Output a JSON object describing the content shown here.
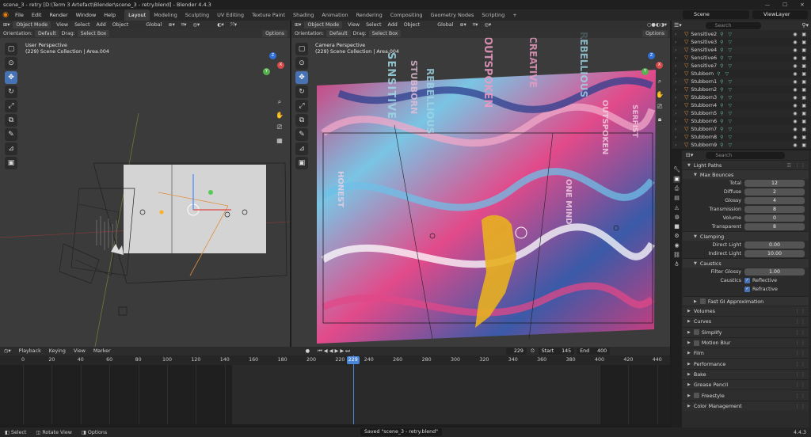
{
  "window": {
    "title": "scene_3 - retry [D:\\Term 3 Artefact\\Blender\\scene_3 - retry.blend] - Blender 4.4.3",
    "controls": [
      "—",
      "☐",
      "✕"
    ]
  },
  "menu": [
    "File",
    "Edit",
    "Render",
    "Window",
    "Help"
  ],
  "workspaces": [
    "Layout",
    "Modeling",
    "Sculpting",
    "UV Editing",
    "Texture Paint",
    "Shading",
    "Animation",
    "Rendering",
    "Compositing",
    "Geometry Nodes",
    "Scripting",
    "+"
  ],
  "active_workspace": "Layout",
  "scene_selector": {
    "scene": "Scene",
    "view_layer": "ViewLayer"
  },
  "viewport_left": {
    "mode": "Object Mode",
    "menus": [
      "View",
      "Select",
      "Add",
      "Object"
    ],
    "transform": "Global",
    "orientation_label": "Orientation:",
    "orientation_value": "Default",
    "drag_label": "Drag:",
    "drag_value": "Select Box",
    "options": "Options",
    "perspective": "User Perspective",
    "collection": "(229) Scene Collection | Area.004"
  },
  "viewport_right": {
    "mode": "Object Mode",
    "menus": [
      "View",
      "Select",
      "Add",
      "Object"
    ],
    "transform": "Global",
    "orientation_label": "Orientation:",
    "orientation_value": "Default",
    "drag_label": "Drag:",
    "drag_value": "Select Box",
    "options": "Options",
    "perspective": "Camera Perspective",
    "collection": "(229) Scene Collection | Area.004"
  },
  "gizmo": {
    "x": "X",
    "y": "Y",
    "z": "Z"
  },
  "timeline": {
    "menus": [
      "Playback",
      "Keying",
      "View",
      "Marker"
    ],
    "current_frame": "229",
    "start_label": "Start",
    "start": "145",
    "end_label": "End",
    "end": "400",
    "ticks": [
      0,
      20,
      40,
      60,
      80,
      100,
      120,
      140,
      160,
      180,
      200,
      220,
      240,
      260,
      280,
      300,
      320,
      340,
      360,
      380,
      400,
      420,
      440
    ],
    "playhead": "229"
  },
  "status": {
    "select": "Select",
    "rotate": "Rotate View",
    "options": "Options",
    "message": "Saved \"scene_3 - retry.blend\"",
    "version": "4.4.3"
  },
  "outliner": {
    "search_placeholder": "Search",
    "items": [
      "Sensitive2",
      "Sensitive3",
      "Sensitive4",
      "Sensitive6",
      "Sensitive7",
      "Stubborn",
      "Stubborn1",
      "Stubborn2",
      "Stubborn3",
      "Stubborn4",
      "Stubborn5",
      "Stubborn6",
      "Stubborn7",
      "Stubborn8",
      "Stubborn9"
    ]
  },
  "properties": {
    "search_placeholder": "Search",
    "light_paths": "Light Paths",
    "max_bounces": "Max Bounces",
    "bounces": [
      {
        "label": "Total",
        "value": "12"
      },
      {
        "label": "Diffuse",
        "value": "2"
      },
      {
        "label": "Glossy",
        "value": "4"
      },
      {
        "label": "Transmission",
        "value": "8"
      },
      {
        "label": "Volume",
        "value": "0"
      },
      {
        "label": "Transparent",
        "value": "8"
      }
    ],
    "clamping": "Clamping",
    "clamp": [
      {
        "label": "Direct Light",
        "value": "0.00"
      },
      {
        "label": "Indirect Light",
        "value": "10.00"
      }
    ],
    "caustics": "Caustics",
    "filter_glossy_label": "Filter Glossy",
    "filter_glossy": "1.00",
    "caustics_label": "Caustics",
    "reflective": "Reflective",
    "refractive": "Refractive",
    "fast_gi": "Fast GI Approximation",
    "panels": [
      "Volumes",
      "Curves",
      "Simplify",
      "Motion Blur",
      "Film",
      "Performance",
      "Bake",
      "Grease Pencil",
      "Freestyle",
      "Color Management"
    ]
  },
  "colors": {
    "accent": "#4772b3",
    "playhead": "#4a85d6",
    "object_orange": "#e09040"
  },
  "camera_overlay_text": [
    "SENSITIVE",
    "STUBBORN",
    "REBELLIOUS",
    "OUTSPOKEN",
    "CREATIVE",
    "REBELLIOUS",
    "OUTSPOKEN",
    "HONEST",
    "ONE MIND",
    "SERFIST"
  ]
}
